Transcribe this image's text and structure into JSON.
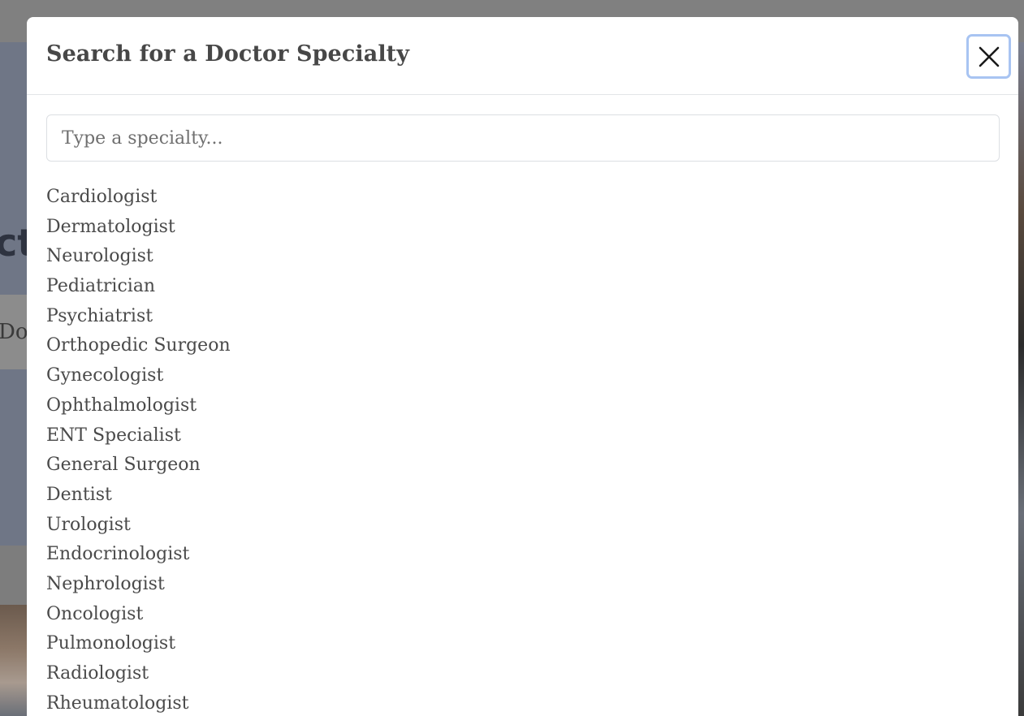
{
  "background": {
    "hero_fragment": "ct",
    "button_fragment": "Do"
  },
  "modal": {
    "title": "Search for a Doctor Specialty",
    "close_icon": "close-icon",
    "search": {
      "placeholder": "Type a specialty...",
      "value": ""
    },
    "specialties": [
      "Cardiologist",
      "Dermatologist",
      "Neurologist",
      "Pediatrician",
      "Psychiatrist",
      "Orthopedic Surgeon",
      "Gynecologist",
      "Ophthalmologist",
      "ENT Specialist",
      "General Surgeon",
      "Dentist",
      "Urologist",
      "Endocrinologist",
      "Nephrologist",
      "Oncologist",
      "Pulmonologist",
      "Radiologist",
      "Rheumatologist"
    ]
  },
  "colors": {
    "overlay": "#7f7f7f",
    "modal_bg": "#ffffff",
    "focus_ring": "#a8c4f2",
    "text": "#474747"
  }
}
